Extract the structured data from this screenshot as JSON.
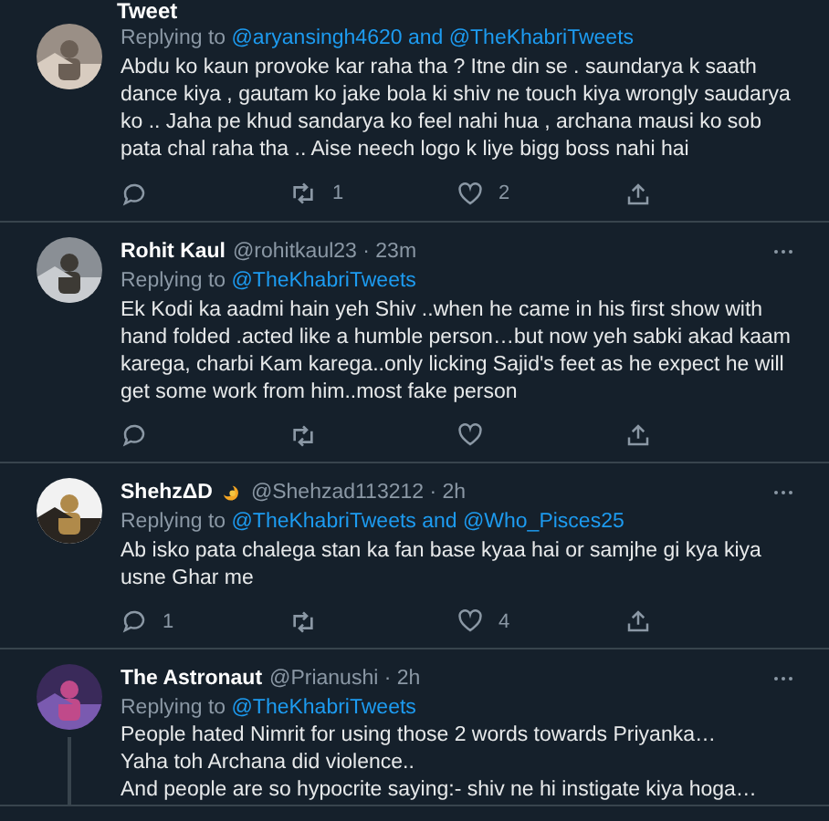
{
  "header": {
    "title": "Tweet"
  },
  "tweets": [
    {
      "avatar": {
        "kind": "picture"
      },
      "replying": {
        "prefix": "Replying to",
        "to": "@aryansingh4620 and @TheKhabriTweets"
      },
      "text": "Abdu ko kaun provoke kar raha tha ? Itne din se . saundarya k saath dance kiya , gautam ko jake bola ki shiv ne touch kiya wrongly saudarya ko .. Jaha pe khud sandarya ko feel nahi hua , archana mausi ko sob pata chal raha tha .. Aise neech logo k liye bigg boss nahi hai",
      "actions": {
        "retweets": "1",
        "likes": "2"
      },
      "badge": false,
      "thread_line": false
    },
    {
      "name": "Rohit Kaul",
      "handle": "@rohitkaul23 · 23m",
      "avatar": {
        "kind": "picture"
      },
      "replying": {
        "prefix": "Replying to",
        "to": "@TheKhabriTweets"
      },
      "text": "Ek Kodi ka aadmi hain yeh Shiv ..when he came in his first show with hand folded .acted like a humble person…but now yeh sabki akad kaam karega, charbi Kam karega..only licking Sajid's feet as he expect he will get some work from him..most fake person",
      "badge": false,
      "thread_line": false
    },
    {
      "name": "ShehzΔD",
      "badge": true,
      "handle": "@Shehzad113212 · 2h",
      "avatar": {
        "kind": "picture"
      },
      "replying": {
        "prefix": "Replying to",
        "to": "@TheKhabriTweets and @Who_Pisces25"
      },
      "text": "Ab isko pata chalega stan ka fan base kyaa hai or samjhe gi kya kiya usne Ghar me",
      "actions": {
        "replies": "1",
        "likes": "4"
      },
      "thread_line": false
    },
    {
      "name": "The Astronaut",
      "handle": "@Prianushi · 2h",
      "avatar": {
        "kind": "picture"
      },
      "replying": {
        "prefix": "Replying to",
        "to": "@TheKhabriTweets"
      },
      "lines": [
        "People hated Nimrit for using those 2 words towards Priyanka…",
        "Yaha toh Archana did violence..",
        "And people are so hypocrite saying:- shiv ne hi instigate kiya hoga…"
      ],
      "badge": false,
      "thread_line": true
    }
  ]
}
